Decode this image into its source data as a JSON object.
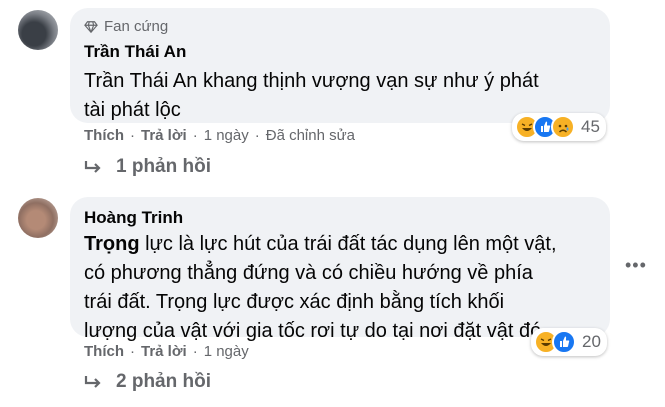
{
  "comment1": {
    "badge_label": "Fan cứng",
    "author": "Trần Thái An",
    "text_line1": "Trần Thái An khang thịnh vượng vạn sự như ý phát",
    "text_line2": "tài phát lộc",
    "actions": {
      "like": "Thích",
      "reply": "Trả lời",
      "time": "1 ngày",
      "edited": "Đã chỉnh sửa"
    },
    "reaction_count": "45",
    "reaction_icons": [
      "haha-icon",
      "like-icon",
      "sad-icon"
    ],
    "replies_label": "1 phản hồi"
  },
  "comment2": {
    "author": "Hoàng Trinh",
    "text_bold": "Trọng",
    "text_line1_rest": " lực là lực hút của trái đất tác dụng lên một vật,",
    "text_line2": "có phương thẳng đứng và có chiều hướng về phía",
    "text_line3": "trái đất. Trọng lực được xác định bằng tích khối",
    "text_line4": "lượng của vật với gia tốc rơi tự do tại nơi đặt vật đó.",
    "actions": {
      "like": "Thích",
      "reply": "Trả lời",
      "time": "1 ngày"
    },
    "reaction_count": "20",
    "reaction_icons": [
      "haha-icon",
      "like-icon"
    ],
    "replies_label": "2 phản hồi"
  },
  "colors": {
    "bubble": "#f0f2f5",
    "secondary_text": "#65676b",
    "like_blue": "#1877f2",
    "emoji_yellow": "#f7b125"
  }
}
